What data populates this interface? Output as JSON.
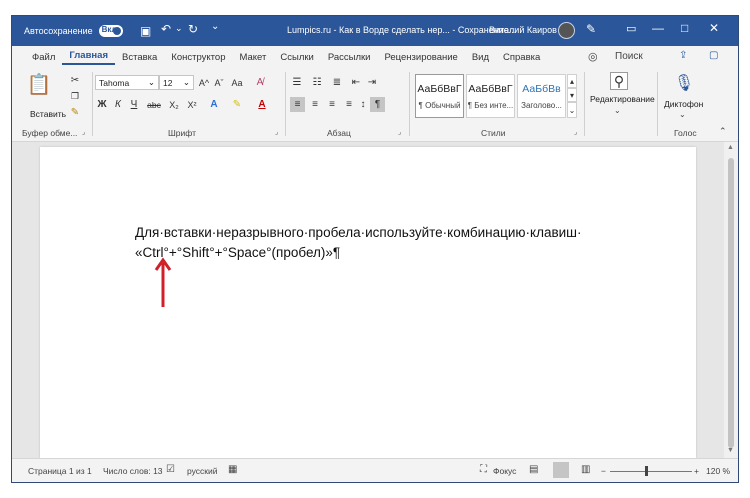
{
  "titlebar": {
    "autosave_label": "Автосохранение",
    "toggle_state": "Вкл.",
    "doc_title": "Lumpics.ru - Как в Ворде сделать нер...  -  Сохранение...",
    "user_name": "Виталий Каиров",
    "bg_color": "#2b579a"
  },
  "tabs": [
    "Файл",
    "Главная",
    "Вставка",
    "Конструктор",
    "Макет",
    "Ссылки",
    "Рассылки",
    "Рецензирование",
    "Вид",
    "Справка"
  ],
  "active_tab": "Главная",
  "search_label": "Поиск",
  "ribbon": {
    "paste_label": "Вставить",
    "font_name": "Tahoma",
    "font_size": "12",
    "bold": "Ж",
    "italic": "К",
    "underline": "Ч",
    "strike": "abc",
    "subscript": "X₂",
    "superscript": "X²",
    "grow_font": "A^",
    "shrink_font": "Aˇ",
    "case": "Aa",
    "styles": [
      {
        "preview": "АаБбВвГ",
        "name": "¶ Обычный"
      },
      {
        "preview": "АаБбВвГ",
        "name": "¶ Без инте..."
      },
      {
        "preview": "АаБбВв",
        "name": "Заголово..."
      }
    ],
    "editing_label": "Редактирование",
    "dictate_label": "Диктофон",
    "groups": {
      "clipboard": "Буфер обме...",
      "font": "Шрифт",
      "paragraph": "Абзац",
      "styles": "Стили",
      "voice": "Голос"
    }
  },
  "document": {
    "line1": "Для·вставки·неразрывного·пробела·используйте·комбинацию·клавиш·",
    "line2": "«Ctrl°+°Shift°+°Space°(пробел)»¶",
    "arrow_color": "#d0212a"
  },
  "statusbar": {
    "page": "Страница 1 из 1",
    "words": "Число слов: 13",
    "language": "русский",
    "focus": "Фокус",
    "zoom": "120 %",
    "zoom_minus": "−",
    "zoom_plus": "+"
  }
}
